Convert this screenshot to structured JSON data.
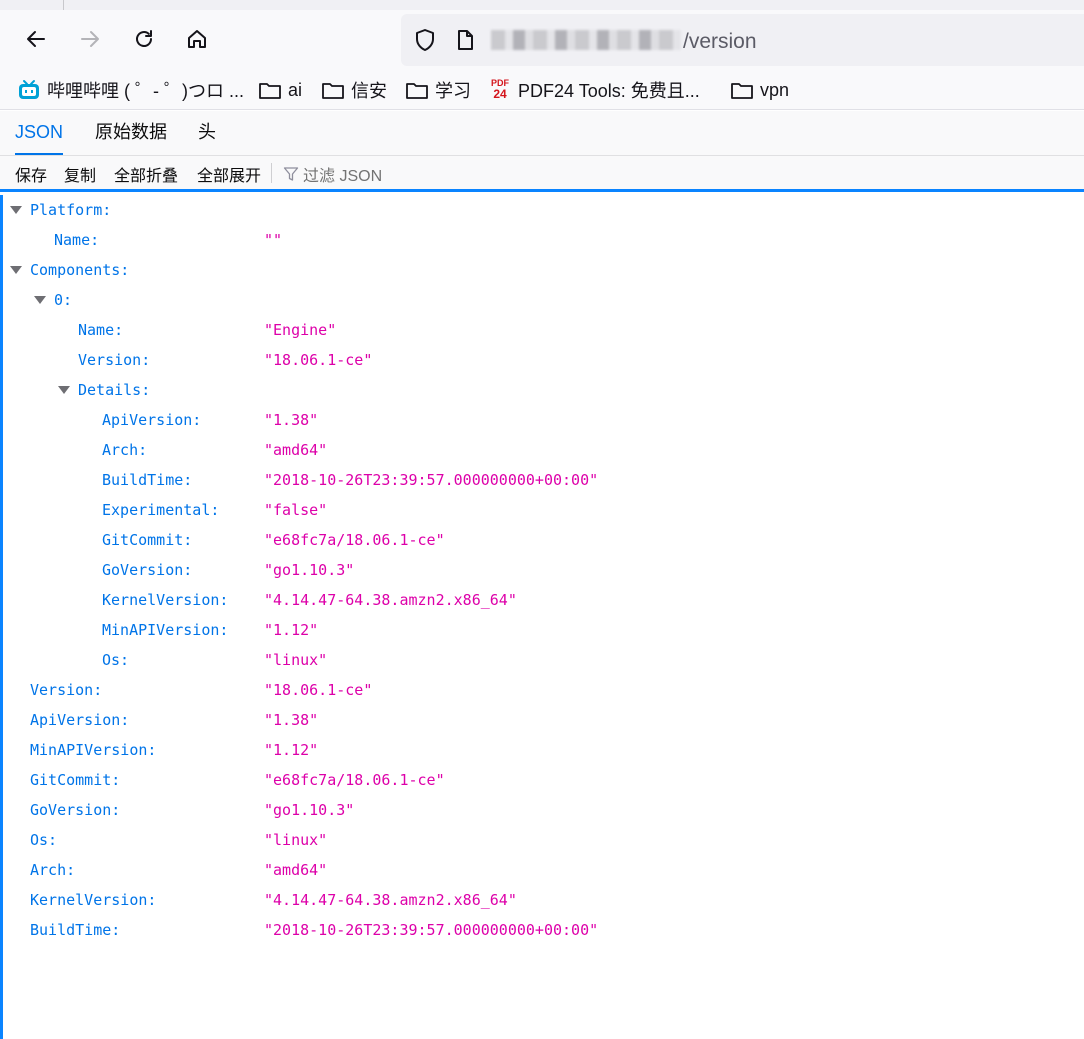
{
  "browser": {
    "url_suffix": "/version",
    "bookmarks": [
      {
        "icon": "bilibili-icon",
        "label": "哔哩哔哩 ( ゜- ゜)つロ ..."
      },
      {
        "icon": "folder-icon",
        "label": "ai"
      },
      {
        "icon": "folder-icon",
        "label": "信安"
      },
      {
        "icon": "folder-icon",
        "label": "学习"
      },
      {
        "icon": "pdf24-icon",
        "label": "PDF24 Tools: 免费且..."
      },
      {
        "icon": "folder-icon",
        "label": "vpn"
      }
    ],
    "pdf_icon_text": [
      "PDF",
      "24"
    ],
    "accent_color": "#0a84ff"
  },
  "viewer": {
    "tabs": [
      "JSON",
      "原始数据",
      "头"
    ],
    "active_tab": "JSON",
    "toolbar": {
      "save": "保存",
      "copy": "复制",
      "collapse_all": "全部折叠",
      "expand_all": "全部展开",
      "filter_placeholder": "过滤 JSON"
    },
    "rows": [
      {
        "key": "Platform:",
        "value": "",
        "level": 0,
        "expander": true
      },
      {
        "key": "Name:",
        "value": "\"\"",
        "level": 1,
        "expander": false
      },
      {
        "key": "Components:",
        "value": "",
        "level": 0,
        "expander": true
      },
      {
        "key": "0:",
        "value": "",
        "level": 1,
        "expander": true
      },
      {
        "key": "Name:",
        "value": "\"Engine\"",
        "level": 2,
        "expander": false
      },
      {
        "key": "Version:",
        "value": "\"18.06.1-ce\"",
        "level": 2,
        "expander": false
      },
      {
        "key": "Details:",
        "value": "",
        "level": 2,
        "expander": true
      },
      {
        "key": "ApiVersion:",
        "value": "\"1.38\"",
        "level": 3,
        "expander": false
      },
      {
        "key": "Arch:",
        "value": "\"amd64\"",
        "level": 3,
        "expander": false
      },
      {
        "key": "BuildTime:",
        "value": "\"2018-10-26T23:39:57.000000000+00:00\"",
        "level": 3,
        "expander": false
      },
      {
        "key": "Experimental:",
        "value": "\"false\"",
        "level": 3,
        "expander": false
      },
      {
        "key": "GitCommit:",
        "value": "\"e68fc7a/18.06.1-ce\"",
        "level": 3,
        "expander": false
      },
      {
        "key": "GoVersion:",
        "value": "\"go1.10.3\"",
        "level": 3,
        "expander": false
      },
      {
        "key": "KernelVersion:",
        "value": "\"4.14.47-64.38.amzn2.x86_64\"",
        "level": 3,
        "expander": false
      },
      {
        "key": "MinAPIVersion:",
        "value": "\"1.12\"",
        "level": 3,
        "expander": false
      },
      {
        "key": "Os:",
        "value": "\"linux\"",
        "level": 3,
        "expander": false
      },
      {
        "key": "Version:",
        "value": "\"18.06.1-ce\"",
        "level": 0,
        "expander": false
      },
      {
        "key": "ApiVersion:",
        "value": "\"1.38\"",
        "level": 0,
        "expander": false
      },
      {
        "key": "MinAPIVersion:",
        "value": "\"1.12\"",
        "level": 0,
        "expander": false
      },
      {
        "key": "GitCommit:",
        "value": "\"e68fc7a/18.06.1-ce\"",
        "level": 0,
        "expander": false
      },
      {
        "key": "GoVersion:",
        "value": "\"go1.10.3\"",
        "level": 0,
        "expander": false
      },
      {
        "key": "Os:",
        "value": "\"linux\"",
        "level": 0,
        "expander": false
      },
      {
        "key": "Arch:",
        "value": "\"amd64\"",
        "level": 0,
        "expander": false
      },
      {
        "key": "KernelVersion:",
        "value": "\"4.14.47-64.38.amzn2.x86_64\"",
        "level": 0,
        "expander": false
      },
      {
        "key": "BuildTime:",
        "value": "\"2018-10-26T23:39:57.000000000+00:00\"",
        "level": 0,
        "expander": false
      }
    ],
    "key_color": "#0074e8",
    "value_color": "#dd00a9"
  }
}
